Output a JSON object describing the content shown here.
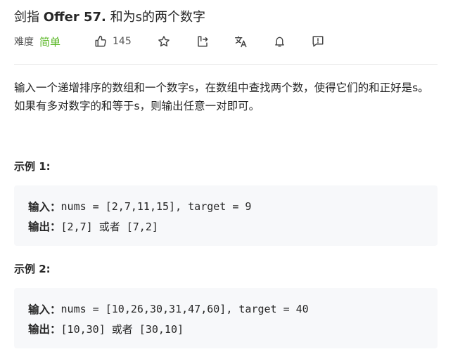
{
  "problem": {
    "title_prefix": "剑指 ",
    "title_en": "Offer 57.",
    "title_rest": " 和为s的两个数字"
  },
  "meta": {
    "difficulty_label": "难度",
    "difficulty_value": "简单",
    "difficulty_color": "#5ab726",
    "like_count": "145",
    "icons": [
      "thumbs-up-icon",
      "star-icon",
      "share-icon",
      "translate-icon",
      "bell-icon",
      "feedback-icon"
    ]
  },
  "description": "输入一个递增排序的数组和一个数字s，在数组中查找两个数，使得它们的和正好是s。如果有多对数字的和等于s，则输出任意一对即可。",
  "examples": [
    {
      "heading": "示例 1:",
      "input_label": "输入：",
      "input_value": "nums = [2,7,11,15], target = 9",
      "output_label": "输出：",
      "output_value": "[2,7] 或者 [7,2]"
    },
    {
      "heading": "示例 2:",
      "input_label": "输入：",
      "input_value": "nums = [10,26,30,31,47,60], target = 40",
      "output_label": "输出：",
      "output_value": "[10,30] 或者 [30,10]"
    }
  ]
}
